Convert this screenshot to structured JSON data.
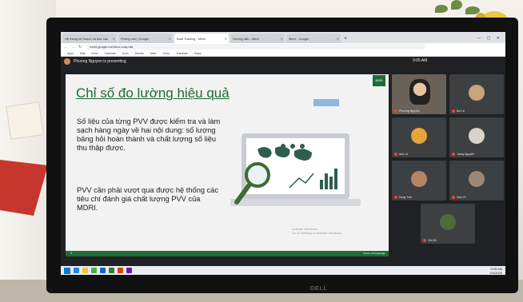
{
  "browser": {
    "tabs": [
      {
        "label": "Hệ thống kế hoạch và báo cáo",
        "active": false
      },
      {
        "label": "Phỏng vấn | Google",
        "active": false
      },
      {
        "label": "Buổi Training - Meet",
        "active": true
      },
      {
        "label": "Hướng dẫn - Meet",
        "active": false
      },
      {
        "label": "Meet - Google",
        "active": false
      }
    ],
    "new_tab": "+",
    "window_controls": "— ▢ ✕",
    "url": "meet.google.com/bcc-oxtq-rda",
    "bookmarks": [
      "Apps",
      "Mail",
      "Drive",
      "Calendar",
      "Docs",
      "Sheets",
      "Meet",
      "Zoom",
      "Translate",
      "Maps"
    ],
    "clock": "9:05 AM"
  },
  "meet": {
    "presenting_text": "Phuong Nguyen is presenting"
  },
  "slide": {
    "title": "Chỉ số đo lường hiệu quả",
    "logo_text": "MDRI",
    "paragraph_1": "Số liệu của từng PVV được kiểm tra và làm sạch hàng ngày về hai nội dung: số lượng bảng hỏi hoàn thành và chất lượng số liệu thu thập được.",
    "paragraph_2": "PVV cần phải vượt qua được hệ thống các tiêu chí đánh giá chất lượng PVV của MDRI.",
    "footer_text": "Power of Knowledge",
    "page_number": "3",
    "activate_line1": "Activate Windows",
    "activate_line2": "Go to Settings to activate Windows."
  },
  "participants": [
    {
      "name": "Phương Nguyễn",
      "avatar_color": "#2b2b2b"
    },
    {
      "name": "Bùi Lê",
      "avatar_color": "#c9a27e"
    },
    {
      "name": "Anh Lê",
      "avatar_color": "#e7a43c"
    },
    {
      "name": "Trang Nguyễn",
      "avatar_color": "#d9d2c7"
    },
    {
      "name": "Dung Trần",
      "avatar_color": "#b58463"
    },
    {
      "name": "Hoa Vũ",
      "avatar_color": "#9b8776"
    },
    {
      "name": "Chi Đỗ",
      "avatar_color": "#4f6b3a"
    }
  ],
  "taskbar": {
    "time": "9:05 AM",
    "date": "3/4/2020"
  },
  "monitor": {
    "brand": "DELL"
  },
  "colors": {
    "slide_green": "#1d6b35",
    "meet_dark": "#202124"
  }
}
